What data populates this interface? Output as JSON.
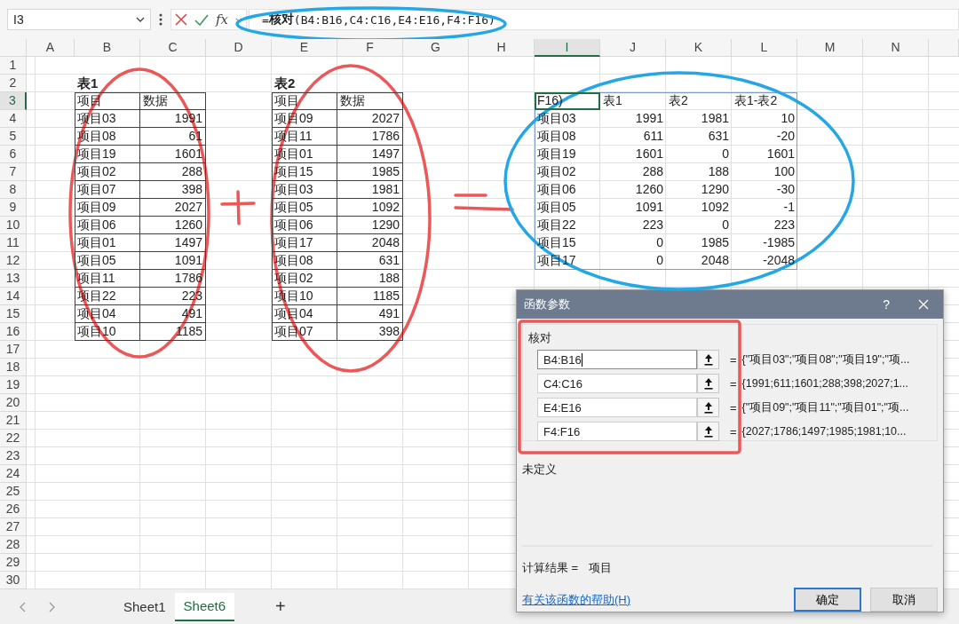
{
  "name_box": "I3",
  "formula_bar": {
    "fx": "fx",
    "formula": "=**核对**(B4:B16,C4:C16,E4:E16,F4:F16)"
  },
  "columns": [
    {
      "label": "A",
      "selected": false
    },
    {
      "label": "B",
      "selected": false
    },
    {
      "label": "C",
      "selected": false
    },
    {
      "label": "D",
      "selected": false
    },
    {
      "label": "E",
      "selected": false
    },
    {
      "label": "F",
      "selected": false
    },
    {
      "label": "G",
      "selected": false
    },
    {
      "label": "H",
      "selected": false
    },
    {
      "label": "I",
      "selected": true
    },
    {
      "label": "J",
      "selected": false
    },
    {
      "label": "K",
      "selected": false
    },
    {
      "label": "L",
      "selected": false
    },
    {
      "label": "M",
      "selected": false
    },
    {
      "label": "N",
      "selected": false
    }
  ],
  "rows": [
    {
      "label": "1",
      "selected": false
    },
    {
      "label": "2",
      "selected": false
    },
    {
      "label": "3",
      "selected": true
    },
    {
      "label": "4",
      "selected": false
    },
    {
      "label": "5",
      "selected": false
    },
    {
      "label": "6",
      "selected": false
    },
    {
      "label": "7",
      "selected": false
    },
    {
      "label": "8",
      "selected": false
    },
    {
      "label": "9",
      "selected": false
    },
    {
      "label": "10",
      "selected": false
    },
    {
      "label": "11",
      "selected": false
    },
    {
      "label": "12",
      "selected": false
    },
    {
      "label": "13",
      "selected": false
    },
    {
      "label": "14",
      "selected": false
    },
    {
      "label": "15",
      "selected": false
    },
    {
      "label": "16",
      "selected": false
    },
    {
      "label": "17",
      "selected": false
    },
    {
      "label": "18",
      "selected": false
    },
    {
      "label": "19",
      "selected": false
    },
    {
      "label": "20",
      "selected": false
    },
    {
      "label": "21",
      "selected": false
    },
    {
      "label": "22",
      "selected": false
    },
    {
      "label": "23",
      "selected": false
    },
    {
      "label": "24",
      "selected": false
    },
    {
      "label": "25",
      "selected": false
    },
    {
      "label": "26",
      "selected": false
    },
    {
      "label": "27",
      "selected": false
    },
    {
      "label": "28",
      "selected": false
    },
    {
      "label": "29",
      "selected": false
    },
    {
      "label": "30",
      "selected": false
    }
  ],
  "tables": [
    {
      "title": "表1",
      "header": [
        "项目",
        "数据"
      ],
      "rows": [
        [
          "项目03",
          "1991"
        ],
        [
          "项目08",
          "61"
        ],
        [
          "项目19",
          "1601"
        ],
        [
          "项目02",
          "288"
        ],
        [
          "项目07",
          "398"
        ],
        [
          "项目09",
          "2027"
        ],
        [
          "项目06",
          "1260"
        ],
        [
          "项目01",
          "1497"
        ],
        [
          "项目05",
          "1091"
        ],
        [
          "项目11",
          "1786"
        ],
        [
          "项目22",
          "223"
        ],
        [
          "项目04",
          "491"
        ],
        [
          "项目10",
          "1185"
        ]
      ]
    },
    {
      "title": "表2",
      "header": [
        "项目",
        "数据"
      ],
      "rows": [
        [
          "项目09",
          "2027"
        ],
        [
          "项目11",
          "1786"
        ],
        [
          "项目01",
          "1497"
        ],
        [
          "项目15",
          "1985"
        ],
        [
          "项目03",
          "1981"
        ],
        [
          "项目05",
          "1092"
        ],
        [
          "项目06",
          "1290"
        ],
        [
          "项目17",
          "2048"
        ],
        [
          "项目08",
          "631"
        ],
        [
          "项目02",
          "188"
        ],
        [
          "项目10",
          "1185"
        ],
        [
          "项目04",
          "491"
        ],
        [
          "项目07",
          "398"
        ]
      ]
    }
  ],
  "result_table": {
    "header": [
      {
        "text": "F16)",
        "active": true
      },
      {
        "text": "表1",
        "active": false
      },
      {
        "text": "表2",
        "active": false
      },
      {
        "text": "表1-表2",
        "active": false
      }
    ],
    "rows": [
      [
        "项目03",
        "1991",
        "1981",
        "10"
      ],
      [
        "项目08",
        "611",
        "631",
        "-20"
      ],
      [
        "项目19",
        "1601",
        "0",
        "1601"
      ],
      [
        "项目02",
        "288",
        "188",
        "100"
      ],
      [
        "项目06",
        "1260",
        "1290",
        "-30"
      ],
      [
        "项目05",
        "1091",
        "1092",
        "-1"
      ],
      [
        "项目22",
        "223",
        "0",
        "223"
      ],
      [
        "项目15",
        "0",
        "1985",
        "-1985"
      ],
      [
        "项目17",
        "0",
        "2048",
        "-2048"
      ]
    ]
  },
  "dialog": {
    "title": "函数参数",
    "help": "?",
    "function_name": "核对",
    "arguments": [
      {
        "value": "B4:B16",
        "focused": true,
        "sign": "=",
        "result": "{\"项目03\";\"项目08\";\"项目19\";\"项..."
      },
      {
        "value": "C4:C16",
        "focused": false,
        "sign": "=",
        "result": "{1991;611;1601;288;398;2027;1..."
      },
      {
        "value": "E4:E16",
        "focused": false,
        "sign": "=",
        "result": "{\"项目09\";\"项目11\";\"项目01\";\"项..."
      },
      {
        "value": "F4:F16",
        "focused": false,
        "sign": "=",
        "result": "{2027;1786;1497;1985;1981;10..."
      }
    ],
    "description": "未定义",
    "result_label": "计算结果 =",
    "result_value": "项目",
    "help_link": "有关该函数的帮助(H)",
    "buttons": [
      {
        "label": "确定",
        "default": true
      },
      {
        "label": "取消",
        "default": false
      }
    ]
  },
  "sheet_tabs": [
    {
      "label": "Sheet1",
      "selected": false
    },
    {
      "label": "Sheet6",
      "selected": true
    }
  ],
  "add_sheet": "+",
  "annotations": [
    {
      "kind": "ellipse",
      "color": "#25a7e6"
    },
    {
      "kind": "ellipse",
      "color": "#ec5757"
    },
    {
      "kind": "plus",
      "color": "#ec5757"
    },
    {
      "kind": "ellipse",
      "color": "#ec5757"
    },
    {
      "kind": "equals",
      "color": "#ec5757"
    },
    {
      "kind": "ellipse",
      "color": "#25a7e6"
    },
    {
      "kind": "rect",
      "color": "#ec5757"
    }
  ]
}
